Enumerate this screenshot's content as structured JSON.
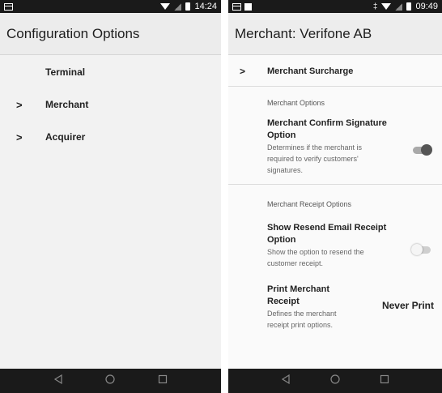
{
  "left": {
    "statusbar": {
      "time": "14:24"
    },
    "appbar_title": "Configuration Options",
    "items": [
      {
        "label": "Terminal",
        "has_chevron": false
      },
      {
        "label": "Merchant",
        "has_chevron": true
      },
      {
        "label": "Acquirer",
        "has_chevron": true
      }
    ],
    "chevron": ">"
  },
  "right": {
    "statusbar": {
      "time": "09:49"
    },
    "appbar_title": "Merchant: Verifone AB",
    "surcharge_label": "Merchant Surcharge",
    "chevron": ">",
    "merchant_options_header": "Merchant Options",
    "confirm_signature": {
      "title_line1": "Merchant Confirm Signature",
      "title_line2": "Option",
      "description_lines": [
        "Determines if the merchant is",
        "required to verify customers'",
        "signatures."
      ],
      "enabled": true
    },
    "receipt_options_header": "Merchant Receipt Options",
    "resend_email": {
      "title_line1": "Show Resend Email Receipt",
      "title_line2": "Option",
      "description_lines": [
        "Show the option to resend the",
        "customer receipt."
      ],
      "enabled": false
    },
    "print_receipt": {
      "title_line1": "Print Merchant",
      "title_line2": "Receipt",
      "description_lines": [
        "Defines the merchant",
        "receipt print options."
      ],
      "value": "Never Print"
    }
  },
  "colors": {
    "statusbar": "#1a1a1a",
    "appbar": "#ececec",
    "toggle_on_knob": "#555555"
  },
  "icons": [
    "message-icon",
    "image-icon",
    "wifi-icon",
    "no-signal-icon",
    "battery-icon",
    "vibrate-icon",
    "back-icon",
    "home-icon",
    "recent-apps-icon"
  ]
}
